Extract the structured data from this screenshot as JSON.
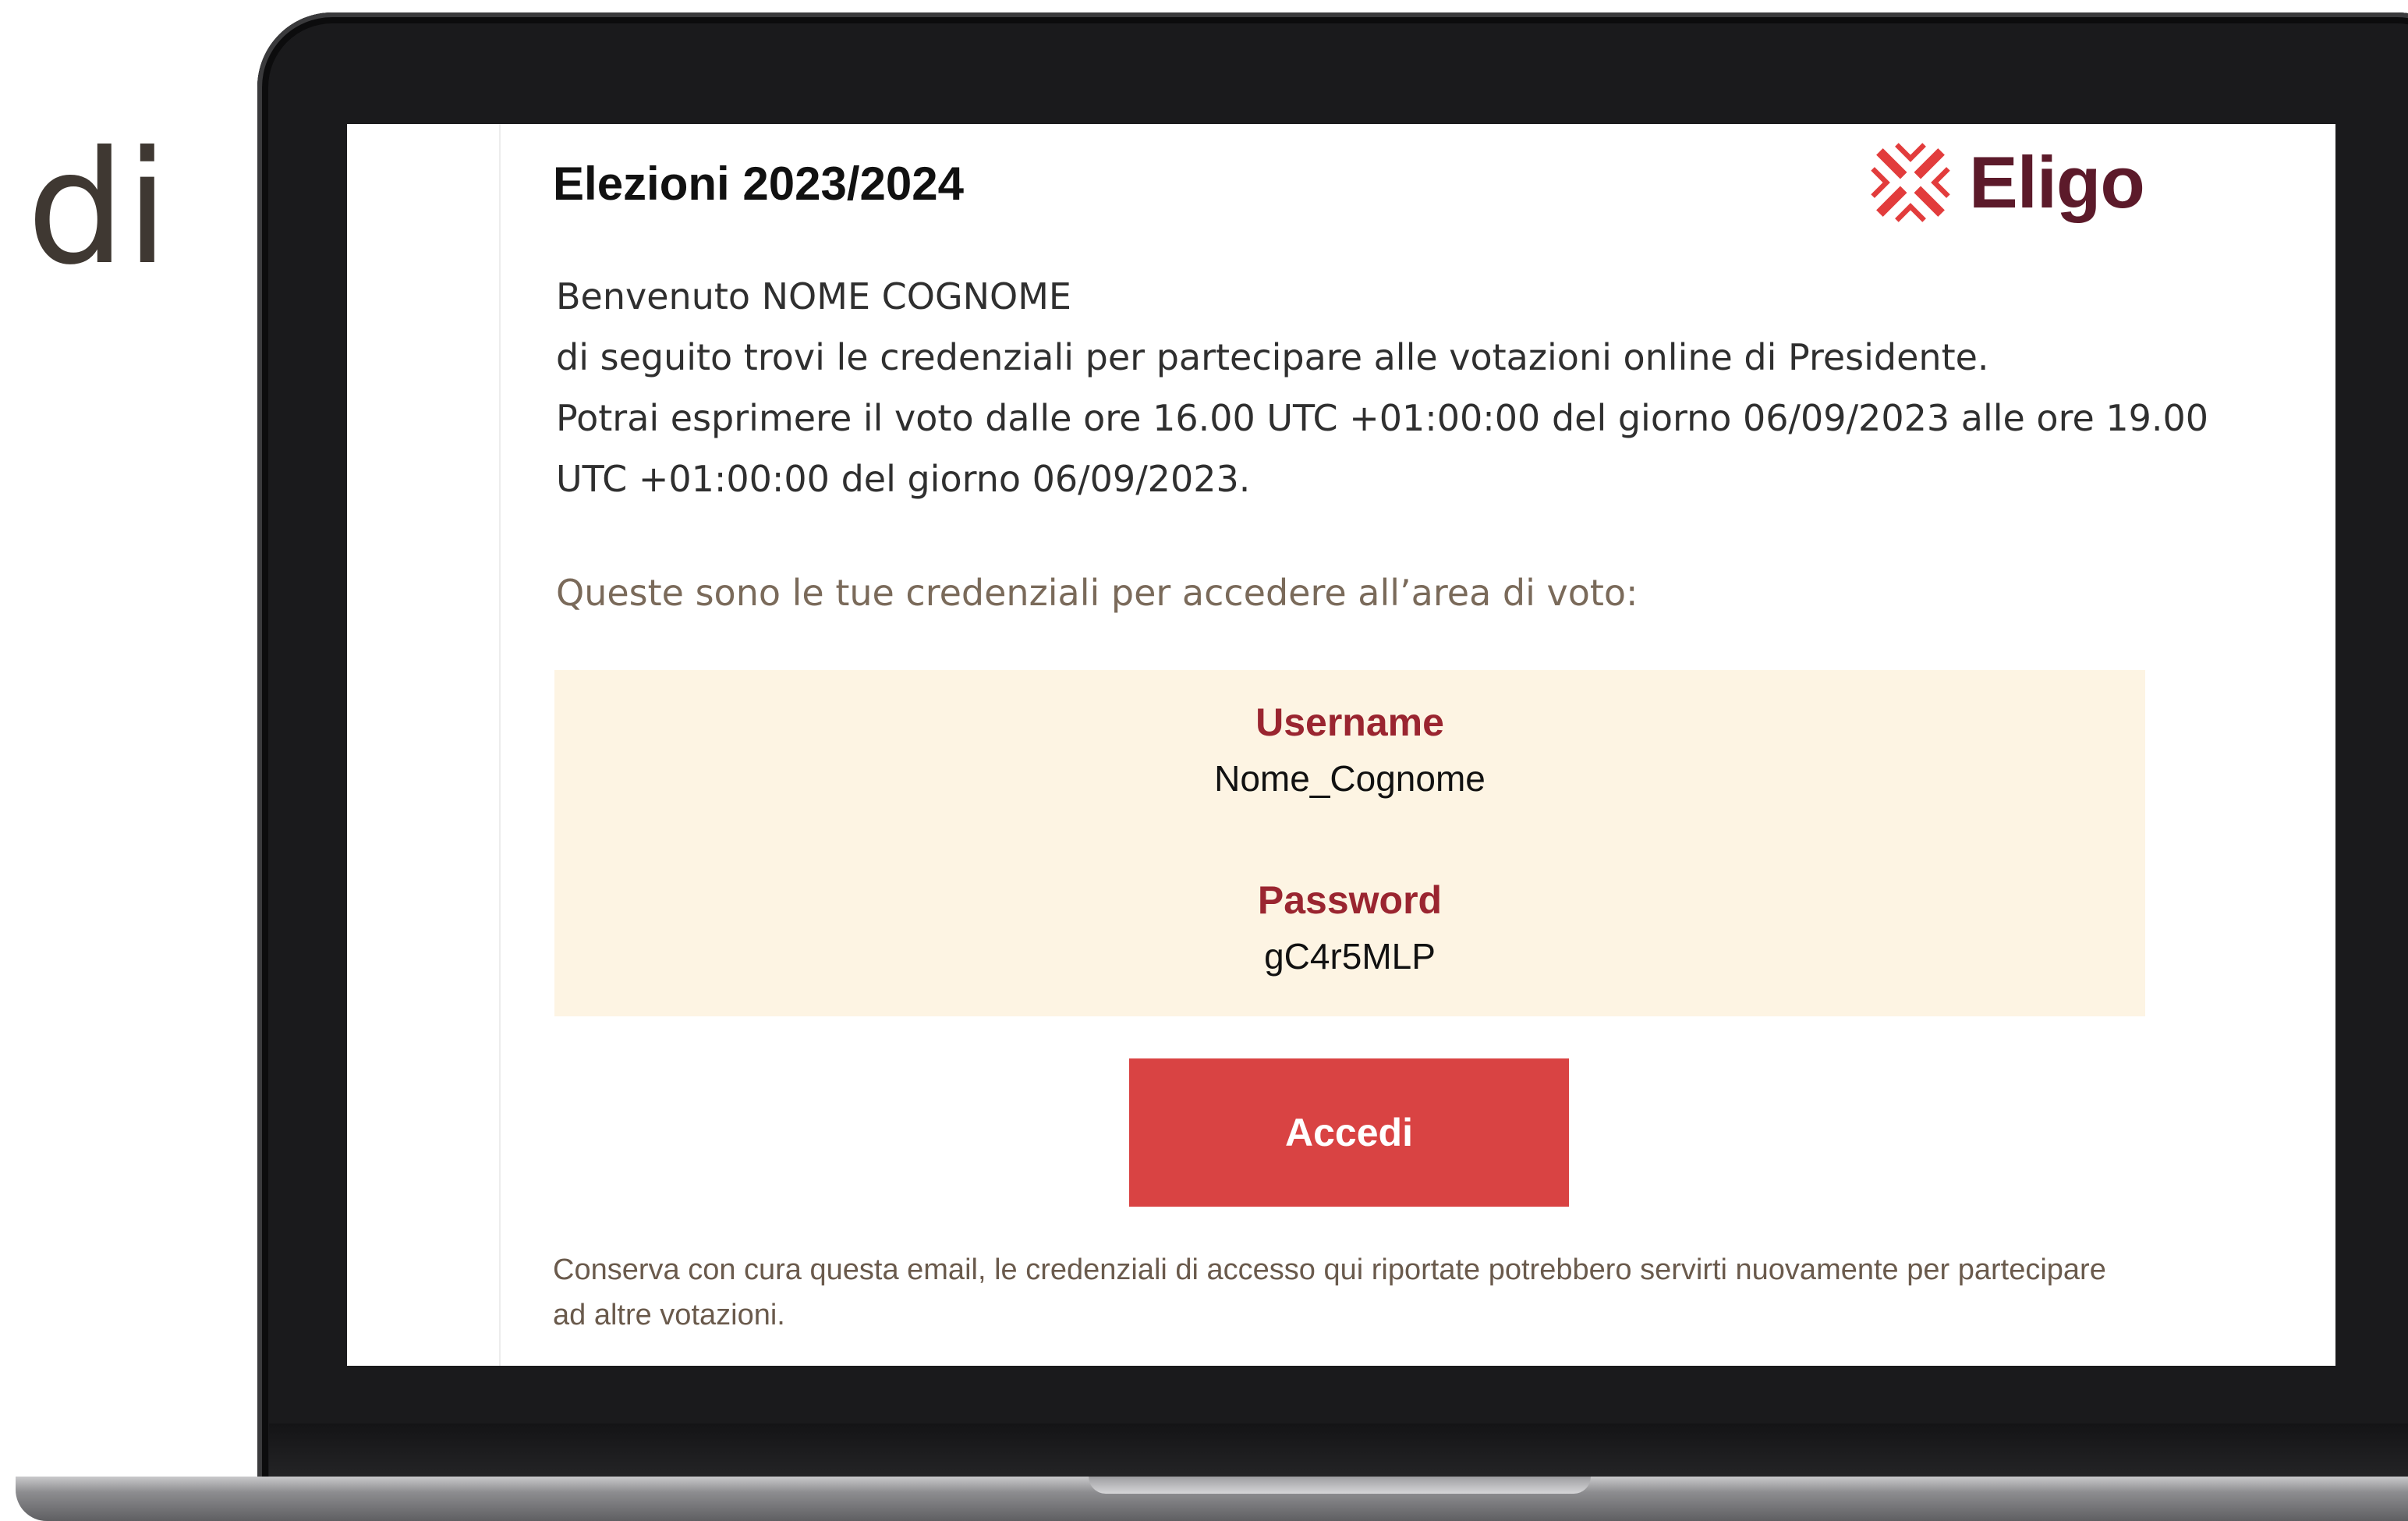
{
  "side_text": "di",
  "email": {
    "title": "Elezioni 2023/2024",
    "logo": {
      "icon": "eligo-x-logo-icon",
      "name": "Eligo",
      "colors": {
        "mark": "#e23c3c",
        "text": "#5c1a2a"
      }
    },
    "intro_lines": [
      "Benvenuto NOME COGNOME",
      "di seguito trovi le credenziali per partecipare alle votazioni online di Presidente.",
      "Potrai esprimere il voto dalle ore 16.00 UTC +01:00:00 del giorno 06/09/2023 alle ore 19.00 UTC +01:00:00 del giorno 06/09/2023."
    ],
    "credentials_intro": "Queste sono le tue credenziali per accedere all’area di voto:",
    "credentials": {
      "username_label": "Username",
      "username_value": "Nome_Cognome",
      "password_label": "Password",
      "password_value": "gC4r5MLP"
    },
    "login_button": "Accedi",
    "footer_note": "Conserva con cura questa email, le credenziali di accesso qui riportate potrebbero servirti nuovamente per partecipare ad altre votazioni.",
    "colors": {
      "accent": "#d94343",
      "label": "#9a2530",
      "credentials_background": "#fdf4e3"
    }
  }
}
